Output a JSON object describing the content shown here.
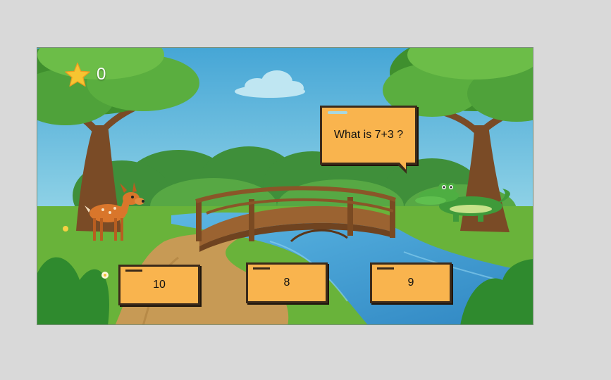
{
  "hud": {
    "score": "0",
    "score_icon": "star-icon"
  },
  "question": {
    "text": "What is 7+3 ?"
  },
  "answers": [
    {
      "label": "10"
    },
    {
      "label": "8"
    },
    {
      "label": "9"
    }
  ],
  "colors": {
    "page_bg": "#d9d9d9",
    "box_fill": "#f9b44e",
    "box_border": "#3b2a1a",
    "sky": "#5fb8df",
    "grass": "#69b33a",
    "river": "#3f9fd4",
    "star": "#f6c531"
  }
}
